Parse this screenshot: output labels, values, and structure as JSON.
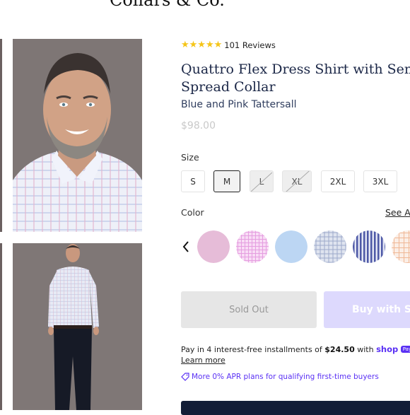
{
  "brand": {
    "name": "Collars & Co."
  },
  "product": {
    "rating_count_label": "101 Reviews",
    "stars": 5,
    "title_line1": "Quattro Flex Dress Shirt with Semi-",
    "title_line2": "Spread Collar",
    "variant": "Blue and Pink Tattersall",
    "price": "$98.00"
  },
  "size": {
    "label": "Size",
    "options": [
      {
        "label": "S",
        "state": "available"
      },
      {
        "label": "M",
        "state": "selected"
      },
      {
        "label": "L",
        "state": "unavailable"
      },
      {
        "label": "XL",
        "state": "unavailable"
      },
      {
        "label": "2XL",
        "state": "available"
      },
      {
        "label": "3XL",
        "state": "available"
      }
    ]
  },
  "color": {
    "label": "Color",
    "see_all": "See All",
    "swatches": [
      {
        "name": "pink-solid",
        "color": "#e6bcd8"
      },
      {
        "name": "pink-check",
        "color": "#f3c9ef"
      },
      {
        "name": "blue-solid",
        "color": "#bcd6f3"
      },
      {
        "name": "blue-grey-check",
        "color": "#c9d1e3"
      },
      {
        "name": "navy-stripe",
        "color": "#6d78b8"
      },
      {
        "name": "orange-check",
        "color": "#f4d9c9"
      }
    ]
  },
  "actions": {
    "sold_out": "Sold Out",
    "buy_with": "Buy with Sh"
  },
  "payment": {
    "installments_prefix": "Pay in 4 interest-free installments of ",
    "installment_amount": "$24.50",
    "installments_suffix": " with ",
    "shop_logo": "shop",
    "pay_badge": "Pay",
    "learn_more": "Learn more",
    "apr": "More 0% APR plans for qualifying first-time buyers"
  },
  "colors": {
    "title": "#1b2747",
    "accent": "#5a31f4",
    "star": "#f5c518",
    "bottom_bar": "#121d36"
  }
}
